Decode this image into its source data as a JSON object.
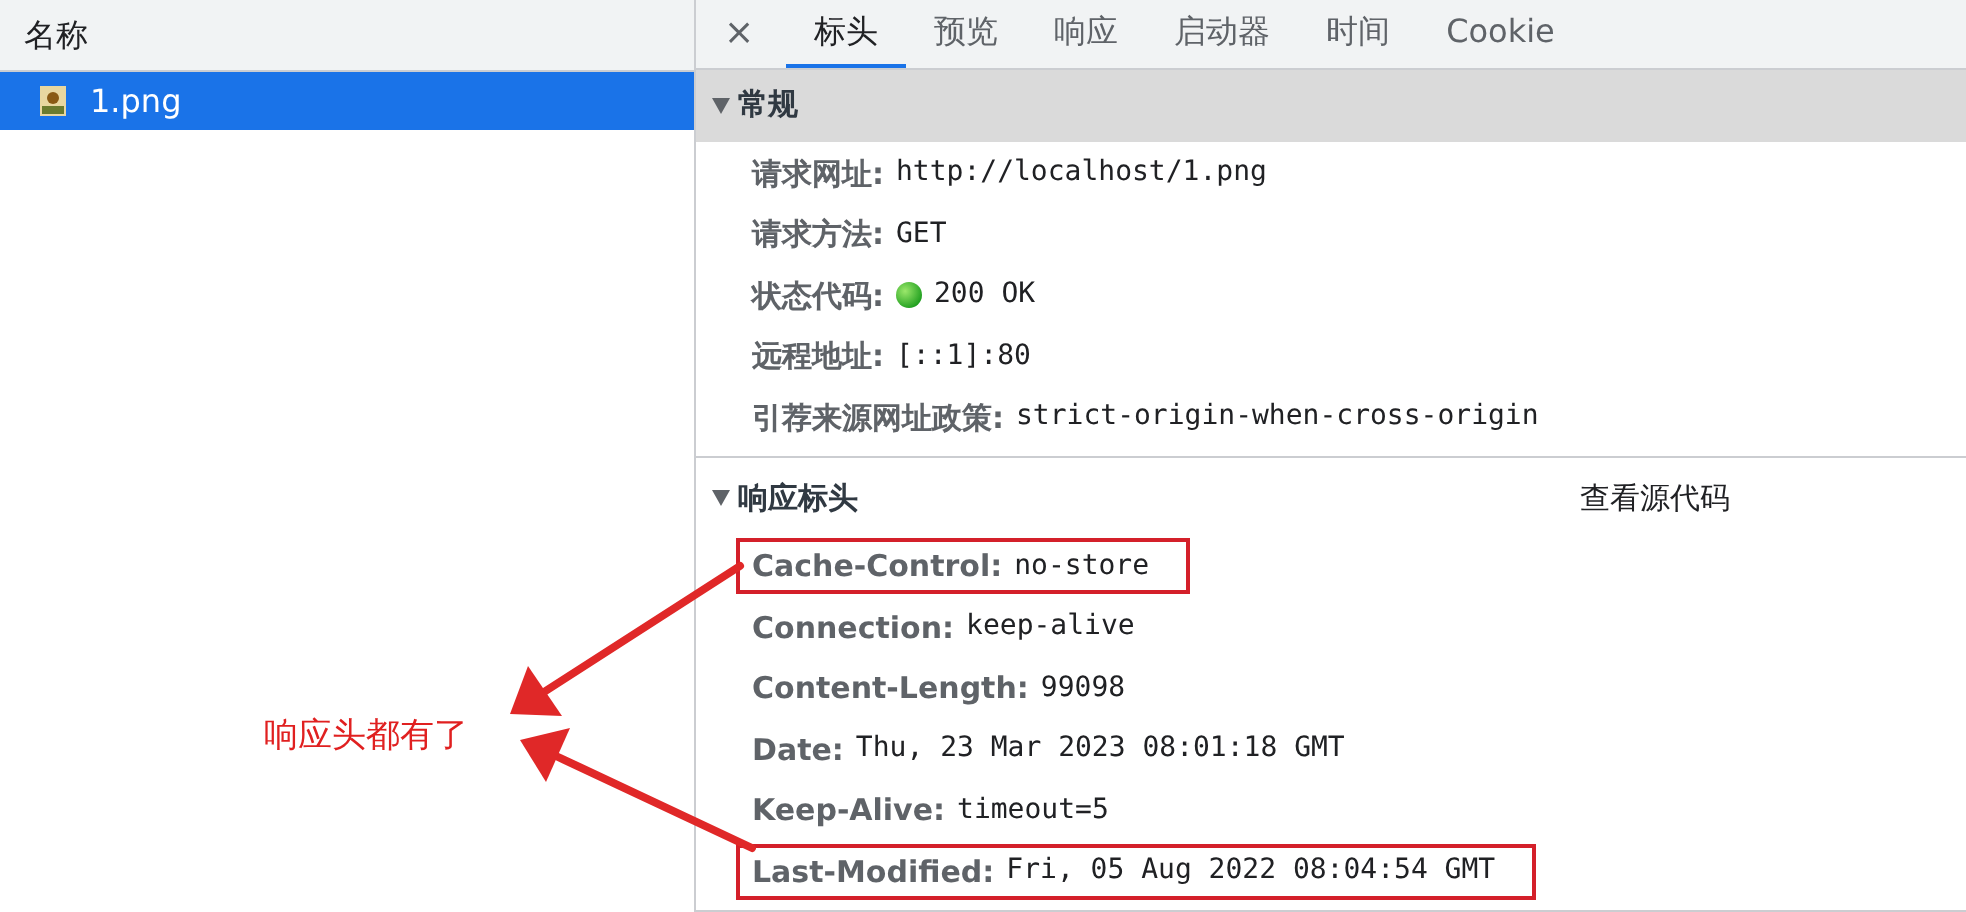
{
  "request_list": {
    "column_header": "名称",
    "rows": [
      {
        "name": "1.png",
        "selected": true
      }
    ]
  },
  "detail": {
    "close": "×",
    "tabs": [
      {
        "label": "标头",
        "selected": true
      },
      {
        "label": "预览",
        "selected": false
      },
      {
        "label": "响应",
        "selected": false
      },
      {
        "label": "启动器",
        "selected": false
      },
      {
        "label": "时间",
        "selected": false
      },
      {
        "label": "Cookie",
        "selected": false
      }
    ],
    "sections": [
      {
        "title": "常规",
        "expanded": true,
        "focused": true,
        "rows": [
          {
            "kind": "text",
            "key": "请求网址:",
            "value": "http://localhost/1.png",
            "highlighted": false
          },
          {
            "kind": "text",
            "key": "请求方法:",
            "value": "GET",
            "highlighted": false
          },
          {
            "kind": "status",
            "key": "状态代码:",
            "value": "200 OK",
            "highlighted": false
          },
          {
            "kind": "text",
            "key": "远程地址:",
            "value": "[::1]:80",
            "highlighted": false
          },
          {
            "kind": "text",
            "key": "引荐来源网址政策:",
            "value": "strict-origin-when-cross-origin",
            "highlighted": false
          }
        ]
      },
      {
        "title": "响应标头",
        "expanded": true,
        "focused": false,
        "action": "查看源代码",
        "rows": [
          {
            "kind": "text",
            "key": "Cache-Control:",
            "value": "no-store",
            "highlighted": true
          },
          {
            "kind": "text",
            "key": "Connection:",
            "value": "keep-alive",
            "highlighted": false
          },
          {
            "kind": "text",
            "key": "Content-Length:",
            "value": "99098",
            "highlighted": false
          },
          {
            "kind": "text",
            "key": "Date:",
            "value": "Thu, 23 Mar 2023 08:01:18 GMT",
            "highlighted": false
          },
          {
            "kind": "text",
            "key": "Keep-Alive:",
            "value": "timeout=5",
            "highlighted": false
          },
          {
            "kind": "text",
            "key": "Last-Modified:",
            "value": "Fri, 05 Aug 2022 08:04:54 GMT",
            "highlighted": true
          }
        ]
      }
    ]
  },
  "annotation": {
    "text": "响应头都有了"
  }
}
